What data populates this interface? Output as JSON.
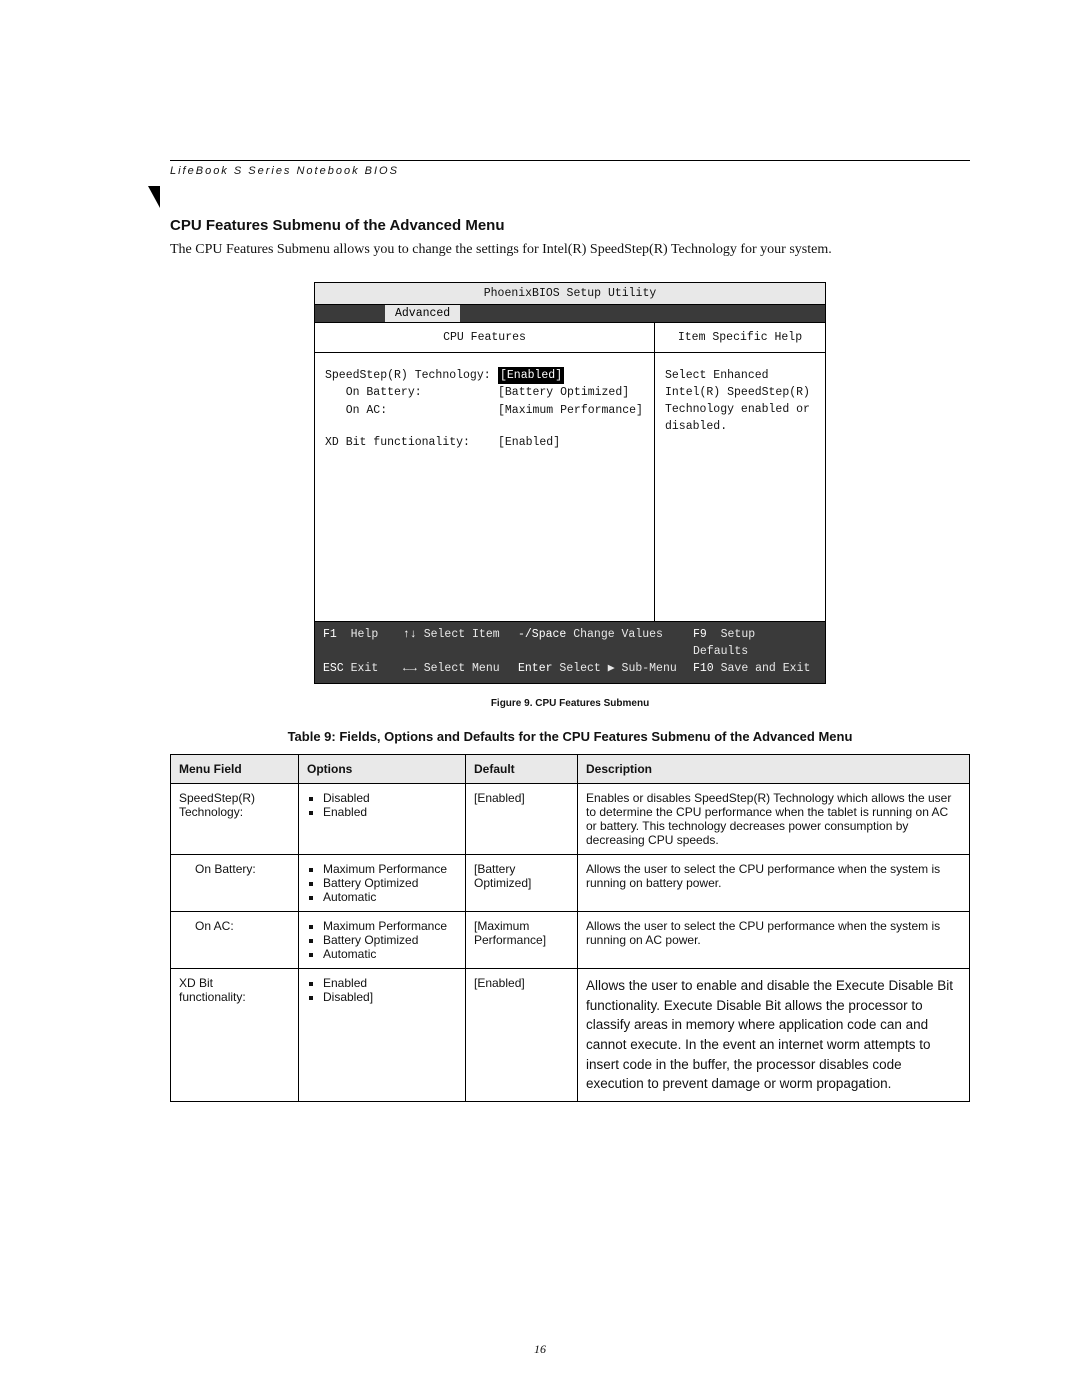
{
  "runhead": "LifeBook S Series Notebook BIOS",
  "section_title": "CPU Features Submenu of the Advanced Menu",
  "intro": "The CPU Features Submenu allows you to change the settings for Intel(R) SpeedStep(R) Technology for your system.",
  "bios": {
    "title": "PhoenixBIOS Setup Utility",
    "tab": "Advanced",
    "left_header": "CPU Features",
    "right_header": "Item Specific Help",
    "rows": {
      "r1": {
        "label": "SpeedStep(R) Technology:",
        "value": "[Enabled]"
      },
      "r2": {
        "label": "   On Battery:",
        "value": "[Battery Optimized]"
      },
      "r3": {
        "label": "   On AC:",
        "value": "[Maximum Performance]"
      },
      "r4": {
        "label": "XD Bit functionality:",
        "value": "[Enabled]"
      }
    },
    "help_text": "Select Enhanced Intel(R) SpeedStep(R) Technology enabled or disabled.",
    "footer": {
      "f1": "F1",
      "help": "Help",
      "sel_item": "Select Item",
      "minus_space": "-/Space",
      "change_values": "Change Values",
      "f9": "F9",
      "setup_defaults": "Setup Defaults",
      "esc": "ESC",
      "exit": "Exit",
      "sel_menu": "Select Menu",
      "enter": "Enter",
      "select_sub": "Select ▶ Sub-Menu",
      "f10": "F10",
      "save_exit": "Save and Exit",
      "arrows_ud": "↑↓",
      "arrows_lr": "←→"
    }
  },
  "figure_caption": "Figure 9.  CPU Features Submenu",
  "table_title": "Table 9: Fields, Options and Defaults for the CPU Features Submenu of the Advanced Menu",
  "table": {
    "headers": {
      "h1": "Menu Field",
      "h2": "Options",
      "h3": "Default",
      "h4": "Description"
    },
    "rows": [
      {
        "menu": "SpeedStep(R)\nTechnology:",
        "options": [
          "Disabled",
          "Enabled"
        ],
        "default": "[Enabled]",
        "description": "Enables or disables SpeedStep(R) Technology which allows the user to determine the CPU performance when the tablet is running on AC or battery. This technology decreases power consumption by decreasing CPU speeds.",
        "indent": false
      },
      {
        "menu": "On Battery:",
        "options": [
          "Maximum Performance",
          "Battery Optimized",
          "Automatic"
        ],
        "default": "[Battery Optimized]",
        "description": "Allows the user to select the CPU performance when the system is running on battery power.",
        "indent": true
      },
      {
        "menu": "On AC:",
        "options": [
          "Maximum Performance",
          "Battery Optimized",
          "Automatic"
        ],
        "default": "[Maximum Performance]",
        "description": "Allows the user to select the CPU performance when the system is running on AC power.",
        "indent": true
      },
      {
        "menu": "XD Bit\nfunctionality:",
        "options": [
          "Enabled",
          "Disabled]"
        ],
        "default": "[Enabled]",
        "description": "Allows the user to enable and disable the Execute Disable Bit functionality.  Execute Disable Bit allows the processor to classify areas in memory where application code can and cannot execute. In the event an internet worm attempts to insert code in the buffer, the processor disables code execution to prevent damage or worm propagation.",
        "indent": false,
        "big": true
      }
    ]
  },
  "page_number": "16"
}
